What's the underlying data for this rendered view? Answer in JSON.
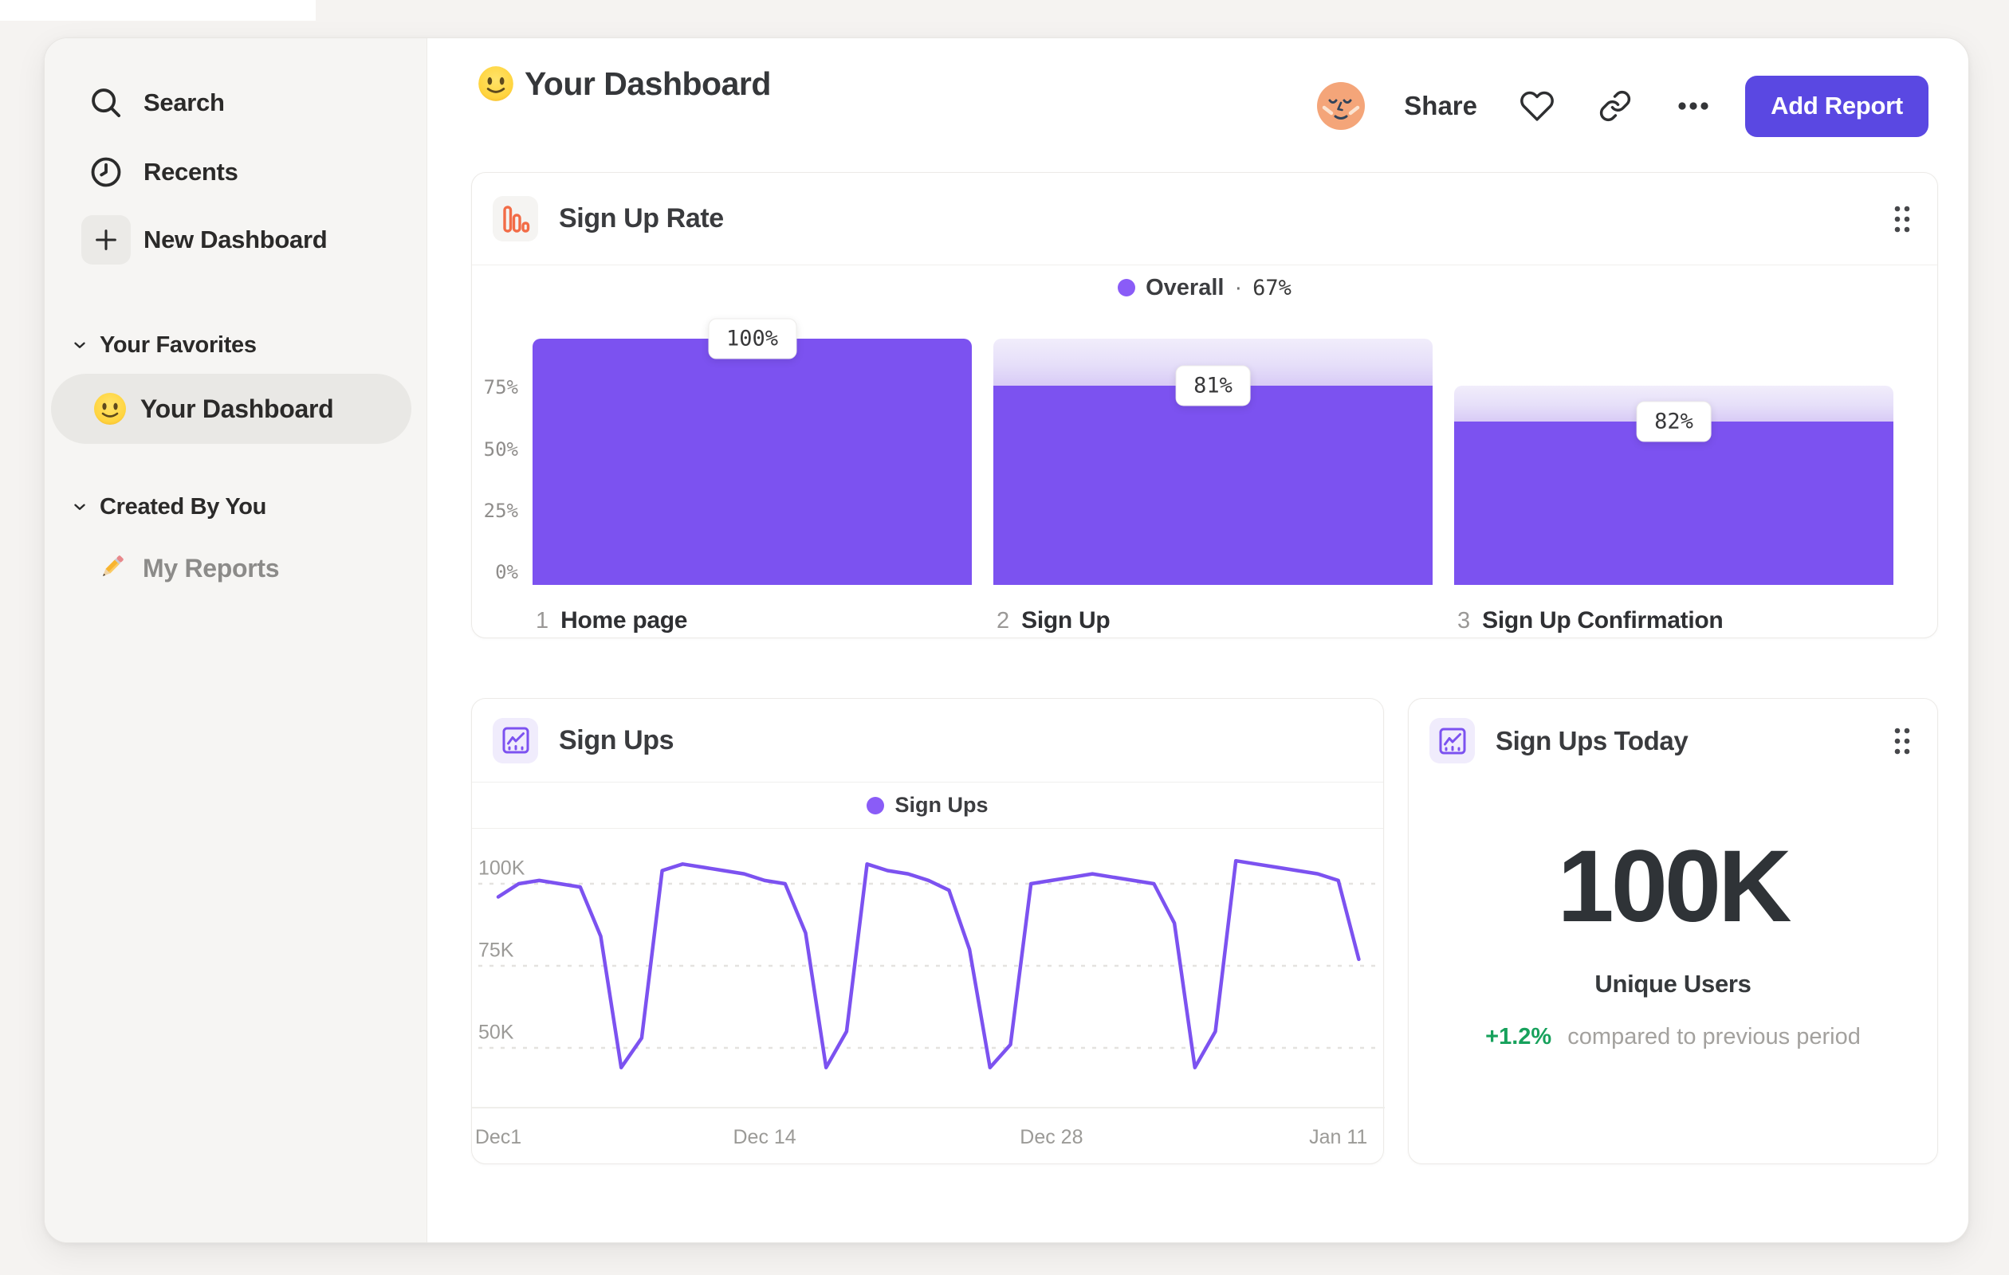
{
  "colors": {
    "accent_purple": "#7C52F0",
    "legend_purple": "#8A5CF7",
    "button_indigo": "#5A48E2",
    "icon_orange": "#F26C47",
    "delta_green": "#17A15C"
  },
  "sidebar": {
    "nav": [
      {
        "label": "Search",
        "icon": "search"
      },
      {
        "label": "Recents",
        "icon": "clock"
      },
      {
        "label": "New Dashboard",
        "icon": "plus"
      }
    ],
    "sections": [
      {
        "title": "Your Favorites",
        "items": [
          {
            "label": "Your Dashboard",
            "icon": "smiley-emoji",
            "selected": true
          }
        ]
      },
      {
        "title": "Created By You",
        "items": [
          {
            "label": "My Reports",
            "icon": "pencil-emoji",
            "selected": false
          }
        ]
      }
    ]
  },
  "header": {
    "emoji": "slightly-smiling-face",
    "title": "Your Dashboard",
    "share_label": "Share",
    "add_report_label": "Add Report"
  },
  "chart_data": [
    {
      "type": "bar",
      "subtype": "funnel",
      "title": "Sign Up Rate",
      "legend": {
        "label": "Overall",
        "separator": "·",
        "value_label": "67%"
      },
      "ylim": [
        0,
        100
      ],
      "y_ticks": [
        "75%",
        "50%",
        "25%",
        "0%"
      ],
      "y_tick_values": [
        75,
        50,
        25,
        0
      ],
      "steps": [
        {
          "step": "1",
          "label": "Home page",
          "value_label": "100%",
          "step_conversion_pct": 100,
          "cumulative_pct": 100
        },
        {
          "step": "2",
          "label": "Sign Up",
          "value_label": "81%",
          "step_conversion_pct": 81,
          "cumulative_pct": 81
        },
        {
          "step": "3",
          "label": "Sign Up Confirmation",
          "value_label": "82%",
          "step_conversion_pct": 82,
          "cumulative_pct": 66.4
        }
      ]
    },
    {
      "type": "line",
      "title": "Sign Ups",
      "legend_label": "Sign Ups",
      "x_ticks": [
        {
          "label": "Dec1",
          "day": 0
        },
        {
          "label": "Dec 14",
          "day": 13
        },
        {
          "label": "Dec 28",
          "day": 27
        },
        {
          "label": "Jan 11",
          "day": 41
        }
      ],
      "y_tick_labels": [
        "100K",
        "75K",
        "50K"
      ],
      "y_gridlines_k": [
        100,
        75,
        50
      ],
      "unit": "sign ups (thousands)",
      "values_k": [
        96,
        100,
        101,
        100,
        99,
        84,
        44,
        53,
        104,
        106,
        105,
        104,
        103,
        101,
        100,
        85,
        44,
        55,
        106,
        104,
        103,
        101,
        98,
        80,
        44,
        51,
        100,
        101,
        102,
        103,
        102,
        101,
        100,
        88,
        44,
        55,
        107,
        106,
        105,
        104,
        103,
        101,
        77
      ]
    },
    {
      "type": "metric",
      "title": "Sign Ups Today",
      "value": "100K",
      "label": "Unique Users",
      "delta": "+1.2%",
      "delta_note": "compared to previous period"
    }
  ]
}
